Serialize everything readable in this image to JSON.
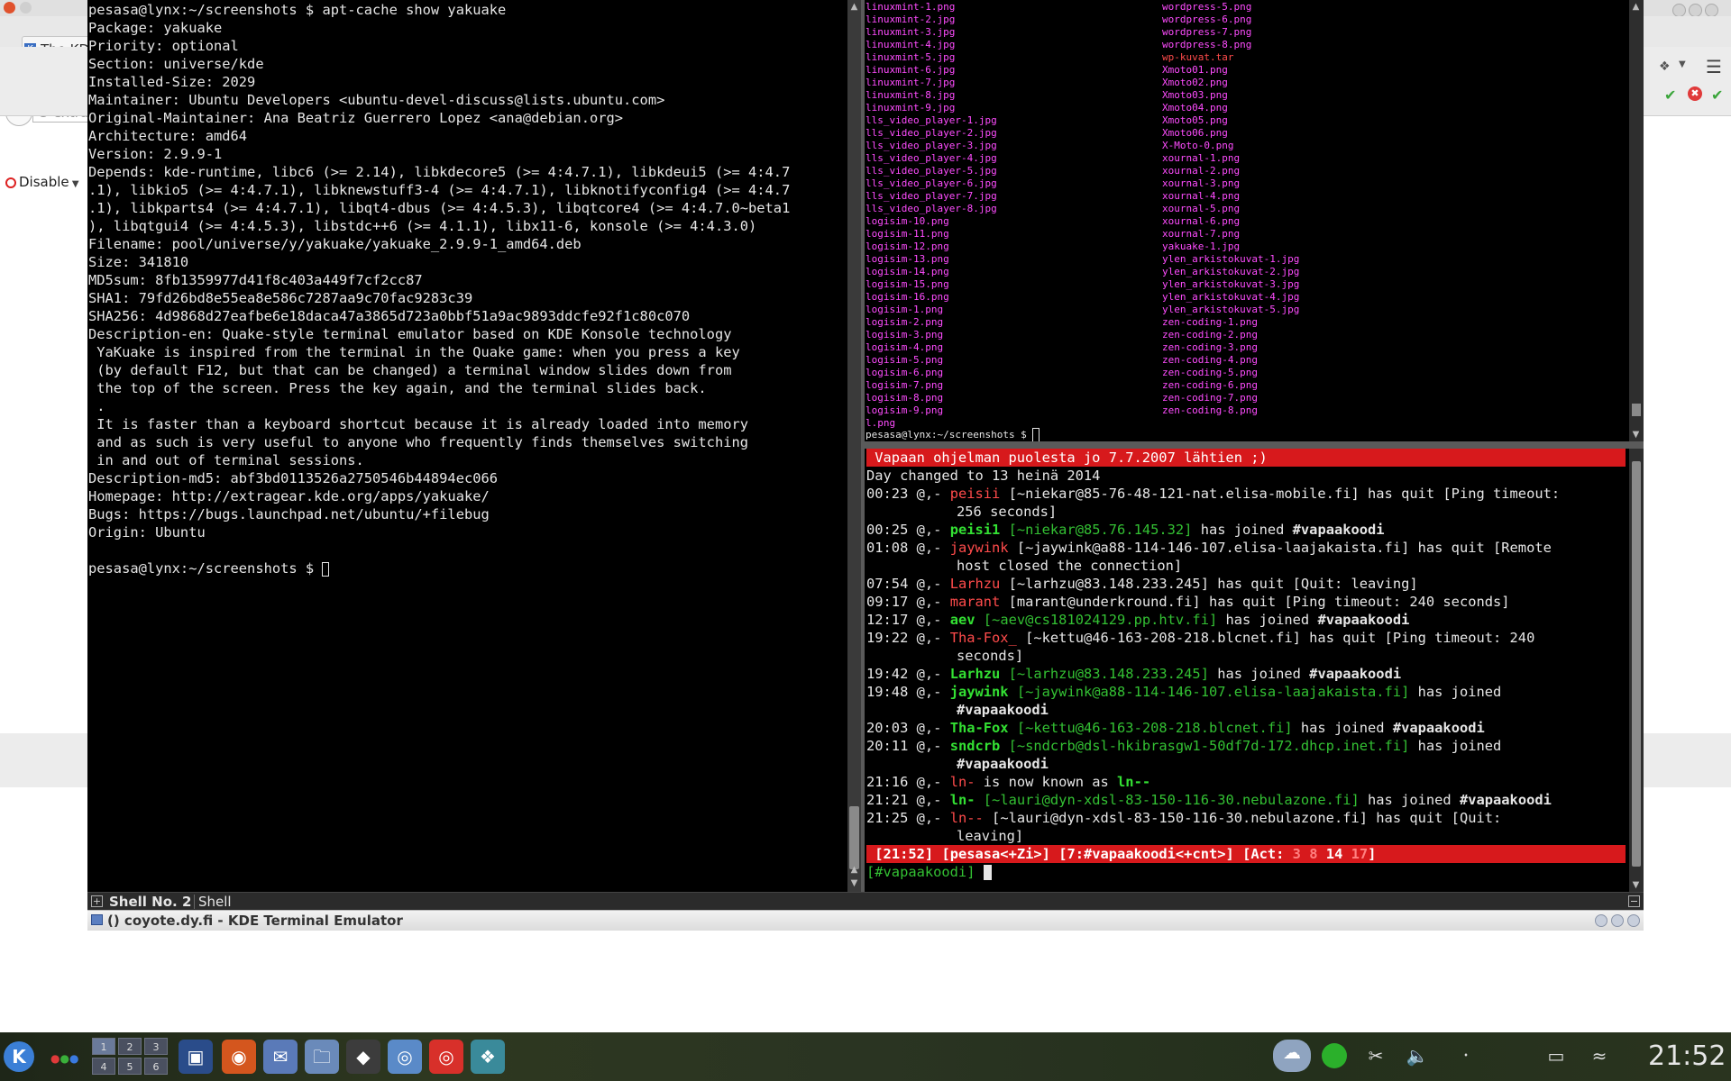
{
  "background_browser": {
    "tab_label": "The KD",
    "url_fragment": "extra",
    "addon_button": "Disable"
  },
  "terminal": {
    "left_pane_lines": [
      "pesasa@lynx:~/screenshots $ apt-cache show yakuake",
      "Package: yakuake",
      "Priority: optional",
      "Section: universe/kde",
      "Installed-Size: 2029",
      "Maintainer: Ubuntu Developers <ubuntu-devel-discuss@lists.ubuntu.com>",
      "Original-Maintainer: Ana Beatriz Guerrero Lopez <ana@debian.org>",
      "Architecture: amd64",
      "Version: 2.9.9-1",
      "Depends: kde-runtime, libc6 (>= 2.14), libkdecore5 (>= 4:4.7.1), libkdeui5 (>= 4:4.7",
      ".1), libkio5 (>= 4:4.7.1), libknewstuff3-4 (>= 4:4.7.1), libknotifyconfig4 (>= 4:4.7",
      ".1), libkparts4 (>= 4:4.7.1), libqt4-dbus (>= 4:4.5.3), libqtcore4 (>= 4:4.7.0~beta1",
      "), libqtgui4 (>= 4:4.5.3), libstdc++6 (>= 4.1.1), libx11-6, konsole (>= 4:4.3.0)",
      "Filename: pool/universe/y/yakuake/yakuake_2.9.9-1_amd64.deb",
      "Size: 341810",
      "MD5sum: 8fb1359977d41f8c403a449f7cf2cc87",
      "SHA1: 79fd26bd8e55ea8e586c7287aa9c70fac9283c39",
      "SHA256: 4d9868d27eafbe6e18daca47a3865d723a0bbf51a9ac9893ddcfe92f1c80c070",
      "Description-en: Quake-style terminal emulator based on KDE Konsole technology",
      " YaKuake is inspired from the terminal in the Quake game: when you press a key",
      " (by default F12, but that can be changed) a terminal window slides down from",
      " the top of the screen. Press the key again, and the terminal slides back.",
      " .",
      " It is faster than a keyboard shortcut because it is already loaded into memory",
      " and as such is very useful to anyone who frequently finds themselves switching",
      " in and out of terminal sessions.",
      "Description-md5: abf3bd0113526a2750546b44894ec066",
      "Homepage: http://extragear.kde.org/apps/yakuake/",
      "Bugs: https://bugs.launchpad.net/ubuntu/+filebug",
      "Origin: Ubuntu",
      "",
      "pesasa@lynx:~/screenshots $ "
    ],
    "file_listing_col1": [
      "linuxmint-1.png",
      "linuxmint-2.jpg",
      "linuxmint-3.jpg",
      "linuxmint-4.jpg",
      "linuxmint-5.jpg",
      "linuxmint-6.jpg",
      "linuxmint-7.jpg",
      "linuxmint-8.jpg",
      "linuxmint-9.jpg",
      "lls_video_player-1.jpg",
      "lls_video_player-2.jpg",
      "lls_video_player-3.jpg",
      "lls_video_player-4.jpg",
      "lls_video_player-5.jpg",
      "lls_video_player-6.jpg",
      "lls_video_player-7.jpg",
      "lls_video_player-8.jpg",
      "logisim-10.png",
      "logisim-11.png",
      "logisim-12.png",
      "logisim-13.png",
      "logisim-14.png",
      "logisim-15.png",
      "logisim-16.png",
      "logisim-1.png",
      "logisim-2.png",
      "logisim-3.png",
      "logisim-4.png",
      "logisim-5.png",
      "logisim-6.png",
      "logisim-7.png",
      "logisim-8.png",
      "logisim-9.png",
      "l.png"
    ],
    "file_listing_col2": [
      "wordpress-5.png",
      "wordpress-6.png",
      "wordpress-7.png",
      "wordpress-8.png",
      "wp-kuvat.tar",
      "Xmoto01.png",
      "Xmoto02.png",
      "Xmoto03.png",
      "Xmoto04.png",
      "Xmoto05.png",
      "Xmoto06.png",
      "X-Moto-0.png",
      "xournal-1.png",
      "xournal-2.png",
      "xournal-3.png",
      "xournal-4.png",
      "xournal-5.png",
      "xournal-6.png",
      "xournal-7.png",
      "yakuake-1.jpg",
      "ylen_arkistokuvat-1.jpg",
      "ylen_arkistokuvat-2.jpg",
      "ylen_arkistokuvat-3.jpg",
      "ylen_arkistokuvat-4.jpg",
      "ylen_arkistokuvat-5.jpg",
      "zen-coding-1.png",
      "zen-coding-2.png",
      "zen-coding-3.png",
      "zen-coding-4.png",
      "zen-coding-5.png",
      "zen-coding-6.png",
      "zen-coding-7.png",
      "zen-coding-8.png"
    ],
    "file_listing_prompt": "pesasa@lynx:~/screenshots $ ",
    "irc": {
      "topic": " Vapaan ohjelman puolesta jo 7.7.2007 lähtien ;)",
      "day_changed": "Day changed to 13 heinä 2014",
      "lines": [
        {
          "time": "00:23",
          "nick": "peisii",
          "nick_style": "red",
          "host": "[~niekar@85-76-48-121-nat.elisa-mobile.fi]",
          "host_style": "plain",
          "action": " has quit [Ping timeout:",
          "cont": "256 seconds]"
        },
        {
          "time": "00:25",
          "nick": "peisi1",
          "nick_style": "green",
          "host": "[~niekar@85.76.145.32]",
          "host_style": "green",
          "action": " has joined ",
          "chan": "#vapaakoodi"
        },
        {
          "time": "01:08",
          "nick": "jaywink",
          "nick_style": "red",
          "host": "[~jaywink@a88-114-146-107.elisa-laajakaista.fi]",
          "host_style": "plain",
          "action": " has quit [Remote",
          "cont": "host closed the connection]"
        },
        {
          "time": "07:54",
          "nick": "Larhzu",
          "nick_style": "red",
          "host": "[~larhzu@83.148.233.245]",
          "host_style": "plain",
          "action": " has quit [Quit: leaving]"
        },
        {
          "time": "09:17",
          "nick": "marant",
          "nick_style": "red",
          "host": "[marant@underkround.fi]",
          "host_style": "plain",
          "action": " has quit [Ping timeout: 240 seconds]"
        },
        {
          "time": "12:17",
          "nick": "aev",
          "nick_style": "green",
          "host": "[~aev@cs181024129.pp.htv.fi]",
          "host_style": "green",
          "action": " has joined ",
          "chan": "#vapaakoodi"
        },
        {
          "time": "19:22",
          "nick": "Tha-Fox_",
          "nick_style": "red",
          "host": "[~kettu@46-163-208-218.blcnet.fi]",
          "host_style": "plain",
          "action": " has quit [Ping timeout: 240",
          "cont": "seconds]"
        },
        {
          "time": "19:42",
          "nick": "Larhzu",
          "nick_style": "green",
          "host": "[~larhzu@83.148.233.245]",
          "host_style": "green",
          "action": " has joined ",
          "chan": "#vapaakoodi"
        },
        {
          "time": "19:48",
          "nick": "jaywink",
          "nick_style": "green",
          "host": "[~jaywink@a88-114-146-107.elisa-laajakaista.fi]",
          "host_style": "green",
          "action": " has joined",
          "cont_chan": "#vapaakoodi"
        },
        {
          "time": "20:03",
          "nick": "Tha-Fox",
          "nick_style": "green",
          "host": "[~kettu@46-163-208-218.blcnet.fi]",
          "host_style": "green",
          "action": " has joined ",
          "chan": "#vapaakoodi"
        },
        {
          "time": "20:11",
          "nick": "sndcrb",
          "nick_style": "green",
          "host": "[~sndcrb@dsl-hkibrasgw1-50df7d-172.dhcp.inet.fi]",
          "host_style": "green",
          "action": " has joined",
          "cont_chan": "#vapaakoodi"
        },
        {
          "time": "21:16",
          "nick": "ln-",
          "nick_style": "red",
          "host": "",
          "host_style": "plain",
          "action": " is now known as ",
          "newnick": "ln--"
        },
        {
          "time": "21:21",
          "nick": "ln-",
          "nick_style": "green",
          "host": "[~lauri@dyn-xdsl-83-150-116-30.nebulazone.fi]",
          "host_style": "green",
          "action": " has joined ",
          "chan": "#vapaakoodi"
        },
        {
          "time": "21:25",
          "nick": "ln--",
          "nick_style": "red",
          "host": "[~lauri@dyn-xdsl-83-150-116-30.nebulazone.fi]",
          "host_style": "plain",
          "action": " has quit [Quit:",
          "cont": "leaving]"
        }
      ],
      "status": {
        "time": "[21:52]",
        "user": "[pesasa<+Zi>]",
        "channel": "[7:#vapaakoodi<+cnt>]",
        "act_label": "[Act: ",
        "act_3": "3",
        "act_8": "8",
        "act_14": "14",
        "act_17": "17",
        "act_end": "]"
      },
      "input_prompt": "[#vapaakoodi] "
    },
    "tabs": [
      "Shell No. 2",
      "Shell"
    ],
    "window_title": "() coyote.dy.fi - KDE Terminal Emulator"
  },
  "taskbar": {
    "clock": "21:52",
    "pager": [
      "1",
      "2",
      "3",
      "4",
      "5",
      "6"
    ]
  }
}
